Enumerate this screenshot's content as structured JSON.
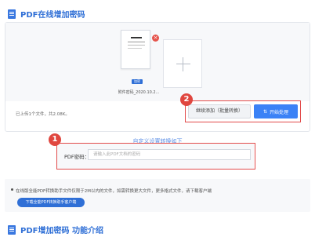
{
  "header": {
    "title": "PDF在线增加密码"
  },
  "upload": {
    "file_name": "附件密码_2020.10.2...",
    "encrypt_badge": "加密",
    "uploaded_info": "已上传1个文件，共2.08K。"
  },
  "actions": {
    "continue_label": "继续添加（批量转换）",
    "convert_label": "开始处理"
  },
  "settings": {
    "title": "自定义设置转换如下",
    "password_label": "PDF密码：",
    "password_placeholder": "请输入此PDF文档的密码",
    "password_value": ""
  },
  "notice": {
    "text": "在线版全能PDF转换助手文件仅限于2M以内的文件，如需转换更大文件，更多格式文件，请下载客户端",
    "download_label": "下载全能PDF转换助手客户端"
  },
  "footer": {
    "intro_title": "PDF增加密码 功能介绍"
  },
  "callouts": [
    "1",
    "2"
  ],
  "colors": {
    "accent": "#2f6fd6",
    "callout": "#e24b4b"
  },
  "icons": {
    "doc": "document-icon",
    "close": "close-icon",
    "add": "plus-icon",
    "swap": "swap-icon"
  }
}
